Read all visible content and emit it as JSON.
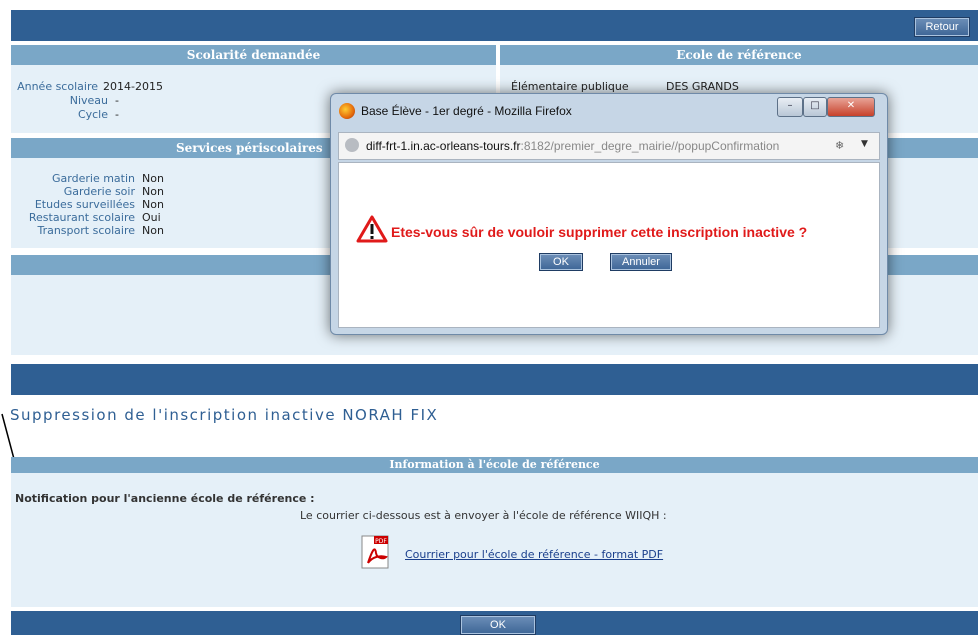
{
  "topbar": {
    "retour_label": "Retour"
  },
  "scolarite": {
    "title": "Scolarité demandée",
    "annee_label": "Année scolaire",
    "annee_value": "2014-2015",
    "niveau_label": "Niveau",
    "niveau_value": "-",
    "cycle_label": "Cycle",
    "cycle_value": "-"
  },
  "ecole": {
    "title": "Ecole de référence",
    "type": "Élémentaire publique",
    "name": "DES GRANDS"
  },
  "services": {
    "title": "Services périscolaires",
    "items": [
      {
        "label": "Garderie matin",
        "value": "Non"
      },
      {
        "label": "Garderie soir",
        "value": "Non"
      },
      {
        "label": "Etudes surveillées",
        "value": "Non"
      },
      {
        "label": "Restaurant scolaire",
        "value": "Oui"
      },
      {
        "label": "Transport scolaire",
        "value": "Non"
      }
    ]
  },
  "suppression": {
    "title": "Suppression de l'inscription inactive NORAH FIX"
  },
  "information": {
    "header": "Information à l'école de référence",
    "notification_label": "Notification pour l'ancienne école de référence :",
    "courrier_text": "Le courrier ci-dessous est à envoyer à l'école de référence WIIQH :",
    "pdf_icon_text": "PDF",
    "pdf_link": "Courrier pour l'école de référence - format PDF"
  },
  "bottom": {
    "ok_label": "OK"
  },
  "dialog": {
    "window_title": "Base Élève - 1er degré - Mozilla Firefox",
    "url_host": "diff-frt-1.in.ac-orleans-tours.fr",
    "url_rest": ":8182/premier_degre_mairie//popupConfirmation",
    "message": "Etes-vous sûr de vouloir supprimer cette inscription inactive ?",
    "ok_label": "OK",
    "annuler_label": "Annuler"
  },
  "colors": {
    "dark_blue": "#2f5f93",
    "panel_header": "#7aa7c7",
    "panel_body": "#e5f0f8",
    "warning_red": "#e01a1a"
  }
}
